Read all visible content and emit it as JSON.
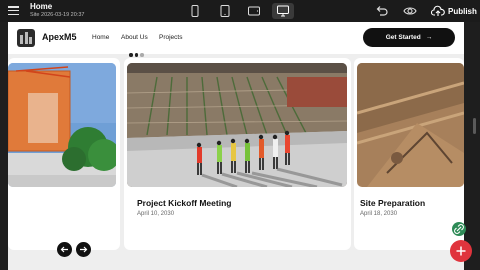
{
  "editor": {
    "page_title": "Home",
    "site_info": "Site 2026-03-19 20:37",
    "publish_label": "Publish",
    "devices": [
      "phone",
      "tablet",
      "tablet-landscape",
      "desktop"
    ],
    "active_device": "desktop"
  },
  "site": {
    "brand": "ApexM5",
    "nav": [
      "Home",
      "About Us",
      "Projects"
    ],
    "cta_label": "Get Started",
    "cta_arrow": "→"
  },
  "carousel": {
    "cards": [
      {
        "title": "",
        "date": ""
      },
      {
        "title": "Project Kickoff Meeting",
        "date": "April 10, 2030"
      },
      {
        "title": "Site Preparation",
        "date": "April 18, 2030"
      }
    ],
    "prev_icon": "arrow-left-icon",
    "next_icon": "arrow-right-icon"
  },
  "colors": {
    "editor_bg": "#1b1b1b",
    "canvas_bg": "#eeeeee",
    "cta_bg": "#111111",
    "fab_link": "#2e8b57",
    "fab_add": "#e0343d"
  }
}
